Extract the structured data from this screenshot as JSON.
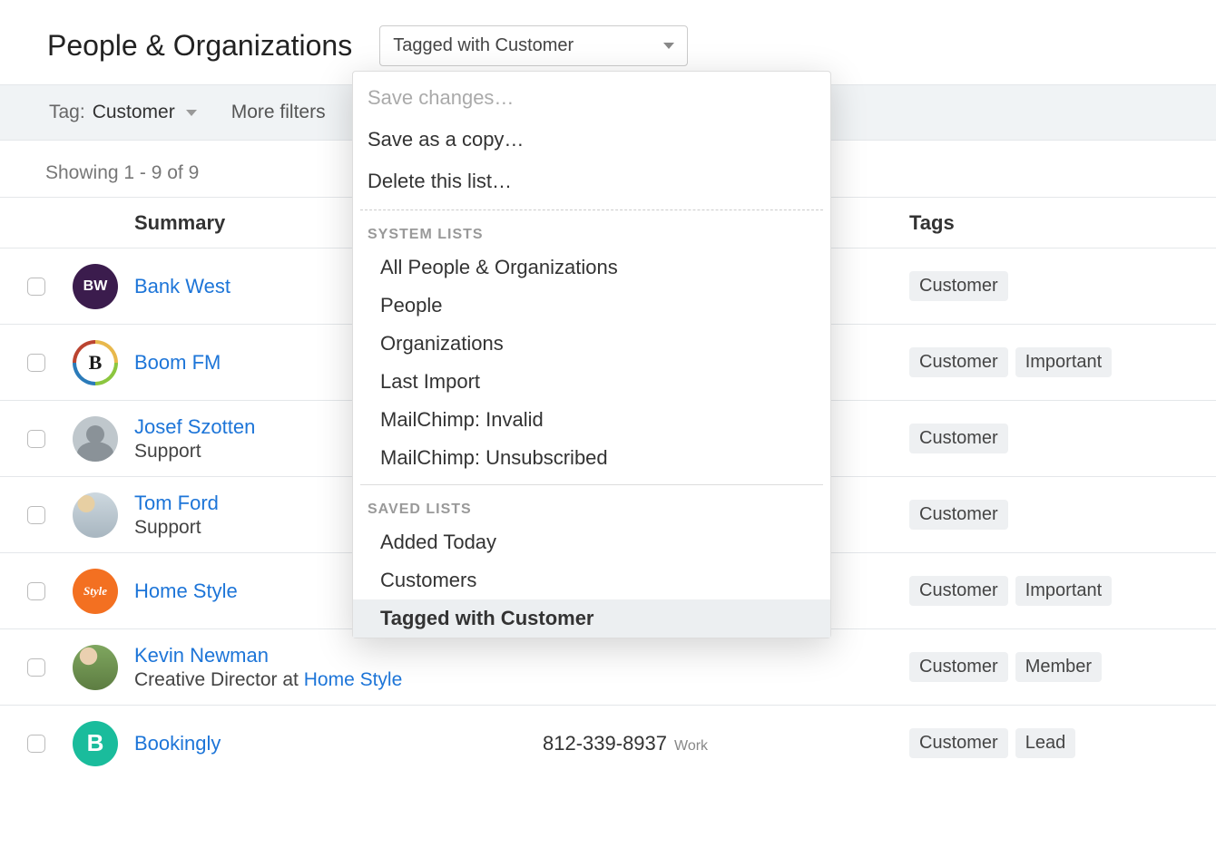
{
  "header": {
    "title": "People & Organizations",
    "dropdown_selected": "Tagged with Customer"
  },
  "filter_bar": {
    "tag_label": "Tag:",
    "tag_value": "Customer",
    "more_filters": "More filters"
  },
  "count_text": "Showing 1 - 9 of 9",
  "columns": {
    "summary": "Summary",
    "tags": "Tags"
  },
  "dropdown": {
    "save_changes": "Save changes…",
    "save_copy": "Save as a copy…",
    "delete_list": "Delete this list…",
    "system_lists_heading": "SYSTEM LISTS",
    "system_lists": [
      "All People & Organizations",
      "People",
      "Organizations",
      "Last Import",
      "MailChimp: Invalid",
      "MailChimp: Unsubscribed"
    ],
    "saved_lists_heading": "SAVED LISTS",
    "saved_lists": [
      "Added Today",
      "Customers",
      "Tagged with Customer"
    ]
  },
  "rows": [
    {
      "name": "Bank West",
      "sub": "",
      "phone": "",
      "phone_type": "",
      "tags": [
        "Customer"
      ],
      "avatar_text": "BW",
      "avatar_class": "av-purple"
    },
    {
      "name": "Boom FM",
      "sub": "",
      "phone": "",
      "phone_type": "",
      "tags": [
        "Customer",
        "Important"
      ],
      "avatar_text": "",
      "avatar_class": "av-ring"
    },
    {
      "name": "Josef Szotten",
      "sub": "Support",
      "phone": "",
      "phone_type": "",
      "tags": [
        "Customer"
      ],
      "avatar_text": "",
      "avatar_class": "av-photo"
    },
    {
      "name": "Tom Ford",
      "sub": "Support",
      "phone": "",
      "phone_type": "",
      "tags": [
        "Customer"
      ],
      "avatar_text": "",
      "avatar_class": "av-photo2"
    },
    {
      "name": "Home Style",
      "sub": "",
      "phone": "",
      "phone_type": "",
      "tags": [
        "Customer",
        "Important"
      ],
      "avatar_text": "Style",
      "avatar_class": "av-orange"
    },
    {
      "name": "Kevin Newman",
      "sub": "Creative Director at ",
      "sub_link": "Home Style",
      "phone": "",
      "phone_type": "",
      "tags": [
        "Customer",
        "Member"
      ],
      "avatar_text": "",
      "avatar_class": "av-photo3"
    },
    {
      "name": "Bookingly",
      "sub": "",
      "phone": "812-339-8937",
      "phone_type": "Work",
      "tags": [
        "Customer",
        "Lead"
      ],
      "avatar_text": "B",
      "avatar_class": "av-teal"
    }
  ]
}
